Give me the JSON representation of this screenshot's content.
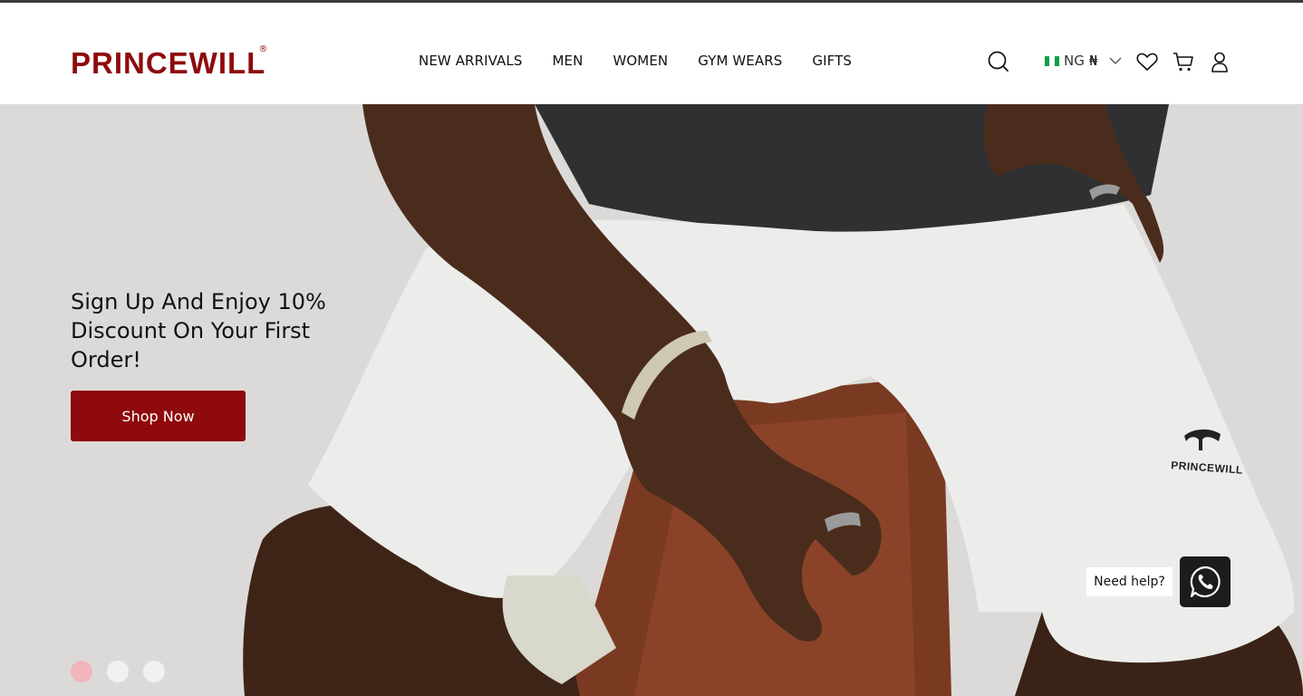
{
  "brand": {
    "logo_text": "PRINCEWILL",
    "logo_reg": "®",
    "accent_color": "#8e0a0c",
    "short_mark_text": "PRINCEWILL"
  },
  "nav": {
    "items": [
      {
        "label": "NEW ARRIVALS"
      },
      {
        "label": "MEN"
      },
      {
        "label": "WOMEN"
      },
      {
        "label": "GYM WEARS"
      },
      {
        "label": "GIFTS"
      }
    ]
  },
  "header_icons": {
    "search": "search-icon",
    "wishlist": "heart-icon",
    "cart": "cart-icon",
    "account": "user-icon"
  },
  "locale": {
    "country": "NG",
    "currency_symbol": "₦",
    "flag_colors": [
      "#008751",
      "#ffffff",
      "#008751"
    ]
  },
  "hero": {
    "headline": "Sign Up And Enjoy 10% Discount On Your First Order!",
    "cta_label": "Shop Now",
    "slides_count": 3,
    "active_slide": 1
  },
  "help": {
    "label": "Need help?",
    "icon": "whatsapp-icon"
  }
}
